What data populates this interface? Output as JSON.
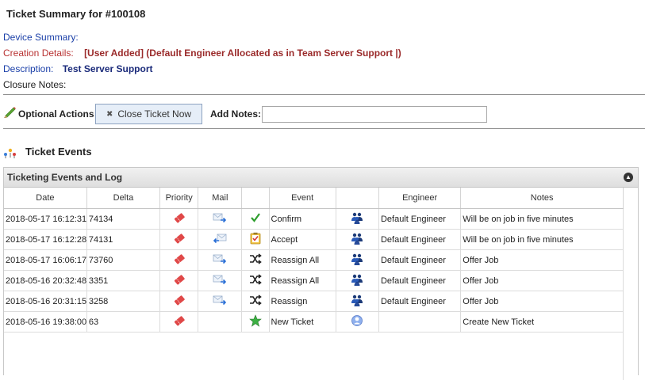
{
  "header": {
    "title": "Ticket Summary for #100108"
  },
  "summary": {
    "device_label": "Device Summary:",
    "creation_label": "Creation Details:",
    "creation_value": "[User Added] (Default Engineer Allocated as in Team Server Support |)",
    "description_label": "Description:",
    "description_value": "Test Server Support",
    "closure_label": "Closure Notes:"
  },
  "actions": {
    "optional_label": "Optional Actions",
    "close_button_label": "Close Ticket Now",
    "add_notes_label": "Add Notes:",
    "notes_value": "",
    "notes_placeholder": ""
  },
  "events": {
    "title": "Ticket Events",
    "panel_title": "Ticketing Events and Log",
    "columns": [
      "Date",
      "Delta",
      "Priority",
      "Mail",
      "",
      "Event",
      "",
      "Engineer",
      "Notes"
    ],
    "rows": [
      {
        "date": "2018-05-17 16:12:31",
        "delta": "74134",
        "priority_icon": "ticket-icon",
        "mail_icon": "mail-out-icon",
        "event_icon": "check-icon",
        "event": "Confirm",
        "engineer_icon": "people-icon",
        "engineer": "Default Engineer",
        "notes": "Will be on job in five minutes"
      },
      {
        "date": "2018-05-17 16:12:28",
        "delta": "74131",
        "priority_icon": "ticket-icon",
        "mail_icon": "mail-in-icon",
        "event_icon": "clipboard-check-icon",
        "event": "Accept",
        "engineer_icon": "people-icon",
        "engineer": "Default Engineer",
        "notes": "Will be on job in five minutes"
      },
      {
        "date": "2018-05-17 16:06:17",
        "delta": "73760",
        "priority_icon": "ticket-icon",
        "mail_icon": "mail-out-icon",
        "event_icon": "shuffle-icon",
        "event": "Reassign All",
        "engineer_icon": "people-icon",
        "engineer": "Default Engineer",
        "notes": "Offer Job"
      },
      {
        "date": "2018-05-16 20:32:48",
        "delta": "3351",
        "priority_icon": "ticket-icon",
        "mail_icon": "mail-out-icon",
        "event_icon": "shuffle-icon",
        "event": "Reassign All",
        "engineer_icon": "people-icon",
        "engineer": "Default Engineer",
        "notes": "Offer Job"
      },
      {
        "date": "2018-05-16 20:31:15",
        "delta": "3258",
        "priority_icon": "ticket-icon",
        "mail_icon": "mail-out-icon",
        "event_icon": "shuffle-icon",
        "event": "Reassign",
        "engineer_icon": "people-icon",
        "engineer": "Default Engineer",
        "notes": "Offer Job"
      },
      {
        "date": "2018-05-16 19:38:00",
        "delta": "63",
        "priority_icon": "ticket-icon",
        "mail_icon": "",
        "event_icon": "star-icon",
        "event": "New Ticket",
        "engineer_icon": "globe-icon",
        "engineer": "",
        "notes": "Create New Ticket"
      }
    ]
  },
  "colors": {
    "label_blue": "#1a3fa8",
    "label_red": "#b83232",
    "value_red": "#9a2a2a",
    "ticket_red": "#e04848",
    "check_green": "#2e9e2e"
  }
}
